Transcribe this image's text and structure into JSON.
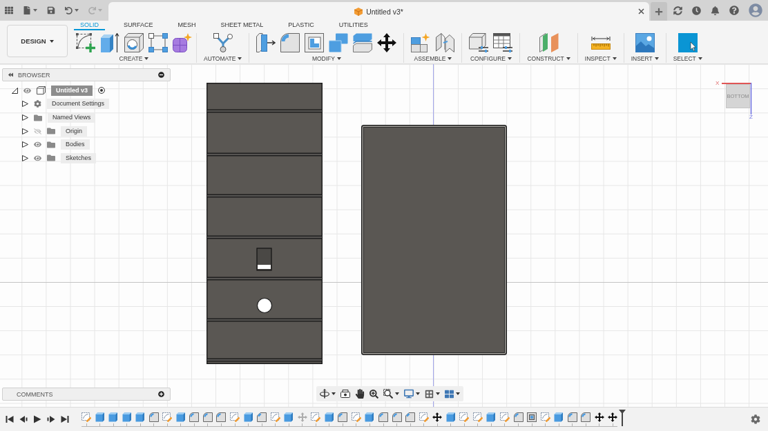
{
  "top_bar": {
    "undo": {
      "disabled": false
    },
    "redo": {
      "disabled": true
    },
    "document_title": "Untitled v3*"
  },
  "toolbar": {
    "workspace": "DESIGN",
    "tabs": [
      {
        "label": "SOLID",
        "selected": true
      },
      {
        "label": "SURFACE",
        "selected": false
      },
      {
        "label": "MESH",
        "selected": false
      },
      {
        "label": "SHEET METAL",
        "selected": false
      },
      {
        "label": "PLASTIC",
        "selected": false
      },
      {
        "label": "UTILITIES",
        "selected": false
      }
    ],
    "groups": [
      "CREATE",
      "AUTOMATE",
      "MODIFY",
      "ASSEMBLE",
      "CONFIGURE",
      "CONSTRUCT",
      "INSPECT",
      "INSERT",
      "SELECT"
    ]
  },
  "browser": {
    "title": "BROWSER",
    "tree": [
      {
        "label": "Untitled v3",
        "kind": "component",
        "expanded": true,
        "visible": true,
        "active": true,
        "children": [
          {
            "label": "Document Settings",
            "kind": "settings",
            "expanded": false
          },
          {
            "label": "Named Views",
            "kind": "folder",
            "expanded": false
          },
          {
            "label": "Origin",
            "kind": "folder",
            "expanded": false,
            "visible": false
          },
          {
            "label": "Bodies",
            "kind": "folder",
            "expanded": false,
            "visible": true
          },
          {
            "label": "Sketches",
            "kind": "folder",
            "expanded": false,
            "visible": true
          }
        ]
      }
    ]
  },
  "view_cube": {
    "face": "BOTTOM",
    "x_axis": "X",
    "z_axis": "Z"
  },
  "comments": {
    "title": "COMMENTS"
  },
  "timeline": {
    "features": [
      {
        "kind": "sketch",
        "dimmed": false
      },
      {
        "kind": "extrude",
        "dimmed": false
      },
      {
        "kind": "extrude",
        "dimmed": false
      },
      {
        "kind": "extrude",
        "dimmed": false
      },
      {
        "kind": "extrude",
        "dimmed": false
      },
      {
        "kind": "fillet",
        "dimmed": false
      },
      {
        "kind": "sketch",
        "dimmed": false
      },
      {
        "kind": "extrude",
        "dimmed": false
      },
      {
        "kind": "fillet",
        "dimmed": false
      },
      {
        "kind": "fillet",
        "dimmed": false
      },
      {
        "kind": "fillet",
        "dimmed": false
      },
      {
        "kind": "sketch",
        "dimmed": false
      },
      {
        "kind": "extrude",
        "dimmed": false
      },
      {
        "kind": "chamfer",
        "dimmed": false
      },
      {
        "kind": "sketch",
        "dimmed": false
      },
      {
        "kind": "extrude",
        "dimmed": false
      },
      {
        "kind": "move",
        "dimmed": true
      },
      {
        "kind": "sketch",
        "dimmed": false
      },
      {
        "kind": "extrude",
        "dimmed": false
      },
      {
        "kind": "fillet",
        "dimmed": false
      },
      {
        "kind": "sketch",
        "dimmed": false
      },
      {
        "kind": "extrude",
        "dimmed": false
      },
      {
        "kind": "fillet",
        "dimmed": false
      },
      {
        "kind": "fillet",
        "dimmed": false
      },
      {
        "kind": "chamfer",
        "dimmed": false
      },
      {
        "kind": "sketch",
        "dimmed": false
      },
      {
        "kind": "move",
        "dimmed": false
      },
      {
        "kind": "extrude",
        "dimmed": false
      },
      {
        "kind": "sketch",
        "dimmed": false
      },
      {
        "kind": "sketch",
        "dimmed": false
      },
      {
        "kind": "extrude",
        "dimmed": false
      },
      {
        "kind": "sketch",
        "dimmed": false
      },
      {
        "kind": "fillet",
        "dimmed": false
      },
      {
        "kind": "shell",
        "dimmed": false
      },
      {
        "kind": "sketch",
        "dimmed": false
      },
      {
        "kind": "extrude",
        "dimmed": false
      },
      {
        "kind": "fillet",
        "dimmed": false
      },
      {
        "kind": "fillet",
        "dimmed": false
      },
      {
        "kind": "move",
        "dimmed": false
      },
      {
        "kind": "move",
        "dimmed": false
      }
    ]
  }
}
